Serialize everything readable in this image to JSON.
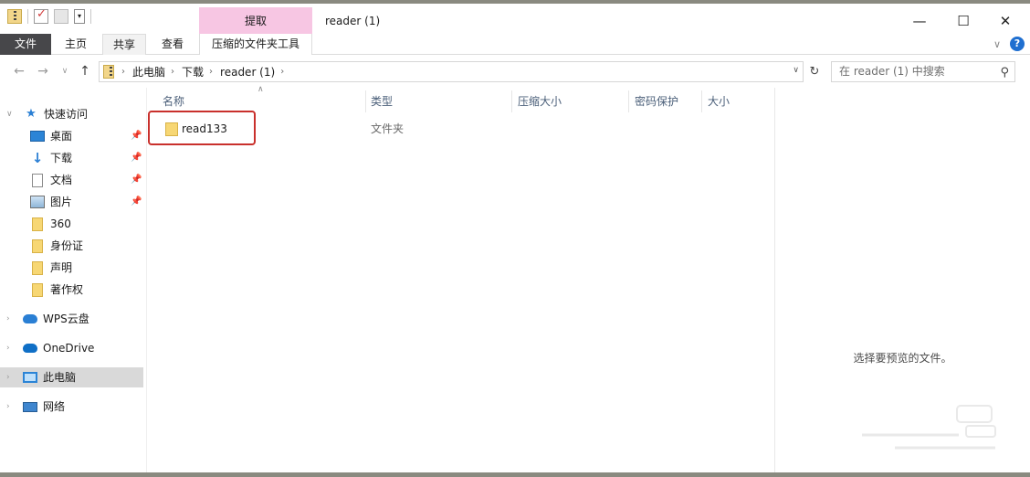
{
  "window": {
    "context_tab_header": "提取",
    "title": "reader (1)"
  },
  "ribbon": {
    "tabs": [
      "文件",
      "主页",
      "共享",
      "查看",
      "压缩的文件夹工具"
    ]
  },
  "address": {
    "crumbs": [
      "此电脑",
      "下载",
      "reader (1)"
    ],
    "search_placeholder": "在 reader (1) 中搜索"
  },
  "nav": {
    "quick_access": "快速访问",
    "pinned": [
      "桌面",
      "下载",
      "文档",
      "图片"
    ],
    "folders": [
      "360",
      "身份证",
      "声明",
      "著作权"
    ],
    "wps_cloud": "WPS云盘",
    "onedrive": "OneDrive",
    "this_pc": "此电脑",
    "network": "网络"
  },
  "columns": [
    "名称",
    "类型",
    "压缩大小",
    "密码保护",
    "大小"
  ],
  "files": [
    {
      "name": "read133",
      "type": "文件夹"
    }
  ],
  "preview": {
    "empty_text": "选择要预览的文件。"
  },
  "colors": {
    "context_tab": "#f7c6e3",
    "file_tab": "#47474a",
    "highlight_box": "#c9302c",
    "selection": "#d9d9d9"
  }
}
